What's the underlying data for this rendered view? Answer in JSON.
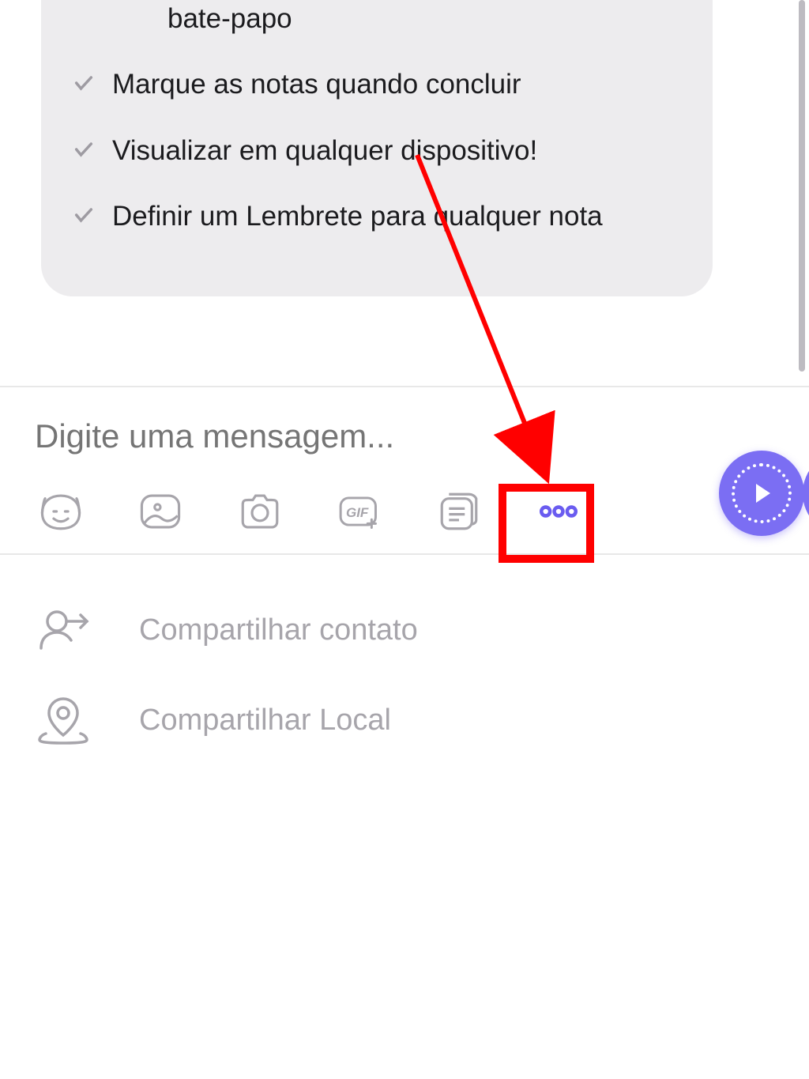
{
  "colors": {
    "accent": "#7b6ef3",
    "highlight_red": "#ff0000"
  },
  "bubble": {
    "top_line": "bate-papo",
    "items": [
      "Marque as notas quando concluir",
      "Visualizar em qualquer dispositivo!",
      "Definir um Lembrete para qualquer nota"
    ]
  },
  "input": {
    "placeholder": "Digite uma mensagem..."
  },
  "toolbar": {
    "sticker_icon": "sticker-icon",
    "gallery_icon": "gallery-icon",
    "camera_icon": "camera-icon",
    "gif_icon": "gif-icon",
    "file_icon": "file-icon",
    "more_icon": "more-icon",
    "record_icon": "record-icon"
  },
  "share_menu": {
    "items": [
      {
        "icon": "share-contact-icon",
        "label": "Compartilhar contato"
      },
      {
        "icon": "share-location-icon",
        "label": "Compartilhar Local"
      }
    ]
  }
}
